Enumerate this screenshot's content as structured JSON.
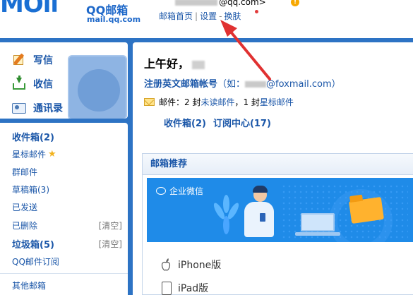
{
  "header": {
    "logo_text": "MOil",
    "brand_name": "QQ邮箱",
    "brand_domain": "mail.qq.com",
    "account_suffix": "@qq.com>",
    "links": {
      "home": "邮箱首页",
      "settings": "设置",
      "skin": "换肤"
    },
    "separator_bar": "|",
    "separator_dash": "-"
  },
  "sidebar": {
    "quick_actions": [
      {
        "label": "写信",
        "icon": "pencil-pad-icon"
      },
      {
        "label": "收信",
        "icon": "inbox-download-icon"
      },
      {
        "label": "通讯录",
        "icon": "contact-card-icon"
      }
    ],
    "folders": [
      {
        "label": "收件箱(2)"
      },
      {
        "label": "星标邮件"
      },
      {
        "label": "群邮件"
      },
      {
        "label": "草稿箱(3)"
      },
      {
        "label": "已发送"
      },
      {
        "label": "已删除",
        "action": "[清空]"
      },
      {
        "label": "垃圾箱(5)",
        "action": "[清空]"
      },
      {
        "label": "QQ邮件订阅"
      },
      {
        "label": "其他邮箱"
      }
    ]
  },
  "main": {
    "greeting": "上午好，",
    "register": {
      "link": "注册英文邮箱帐号",
      "example_prefix": "（如：",
      "example_suffix": "@foxmail.com）"
    },
    "summary": {
      "prefix": "邮件：2 封",
      "unread_link": "未读邮件",
      "middle": "，1 封",
      "starred_link": "星标邮件"
    },
    "quick_links": [
      "收件箱(2)",
      "订阅中心(17)"
    ],
    "recommend": {
      "title": "邮箱推荐",
      "banner_label": "企业微信",
      "apps": [
        {
          "label": "iPhone版",
          "icon": "apple-icon"
        },
        {
          "label": "iPad版",
          "icon": "ipad-icon"
        }
      ]
    }
  },
  "colors": {
    "brand_blue": "#2d73c4",
    "link_blue": "#1a56a8",
    "banner_blue": "#1f8be8",
    "annotation_red": "#e03131",
    "star_gold": "#f2b31e"
  }
}
